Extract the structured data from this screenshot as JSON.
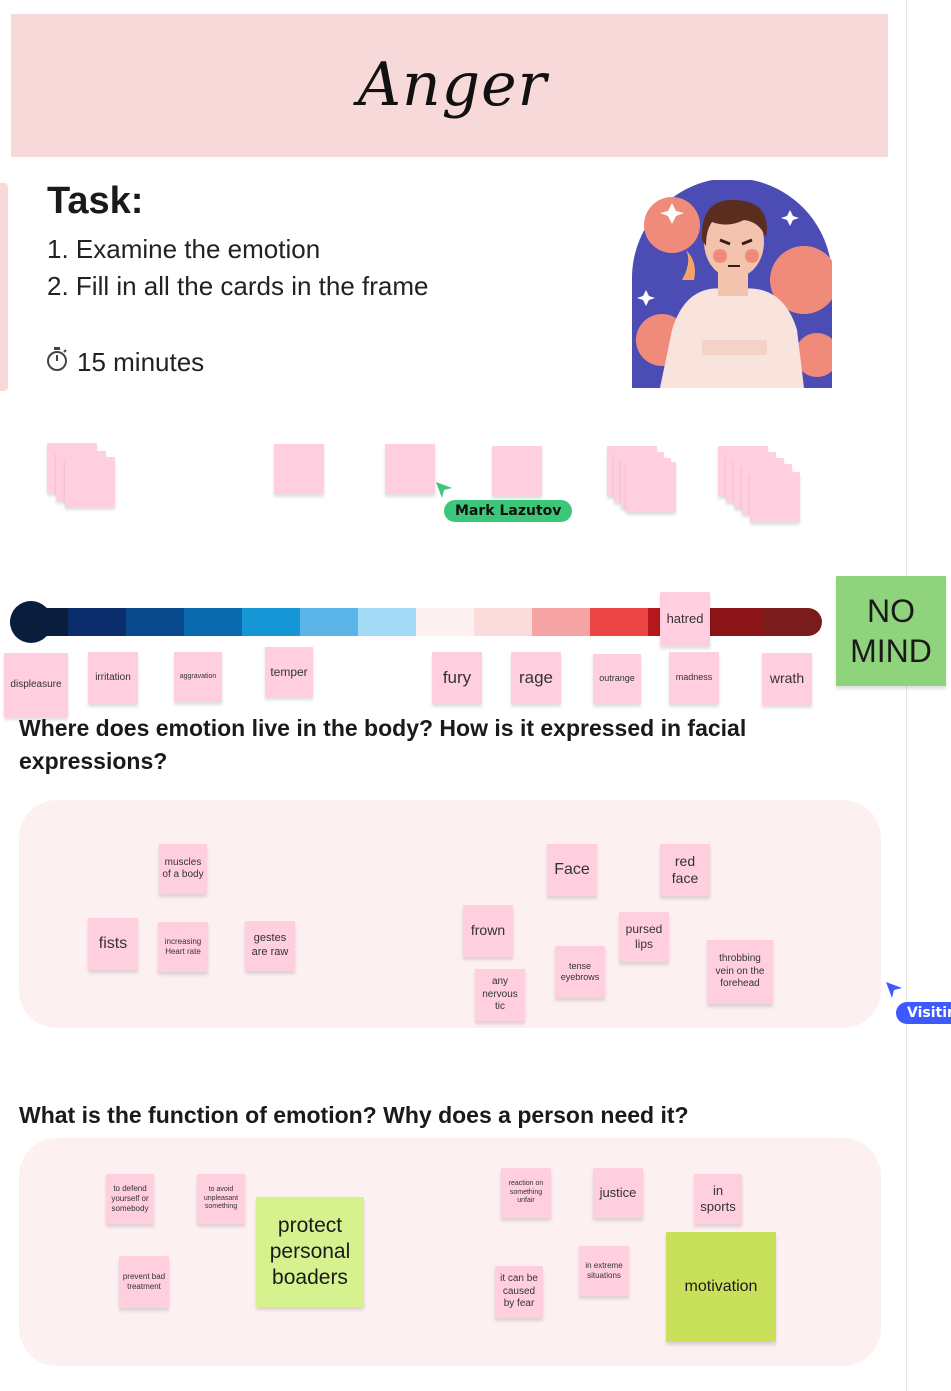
{
  "frame": {
    "title": "Anger"
  },
  "task": {
    "heading": "Task:",
    "steps": [
      "1. Examine the emotion",
      "2. Fill in all the cards in the frame"
    ],
    "timer_icon": "stopwatch-icon",
    "timer_text": "15 minutes"
  },
  "illustration": {
    "name": "angry-person-illustration"
  },
  "collaborators": {
    "cursor_one": {
      "name": "Mark Lazutov",
      "color": "#3cc67a"
    },
    "cursor_two": {
      "name": "Visiting",
      "color": "#3d5afe"
    }
  },
  "scale": {
    "colors": [
      "#0a1d3d",
      "#0c2d6b",
      "#0a4a8c",
      "#0a6aad",
      "#1597d6",
      "#5ab4e8",
      "#a3dbf7",
      "#fdf1f1",
      "#fbdcdc",
      "#f6a3a3",
      "#ec4545",
      "#b5171c",
      "#8b1418",
      "#7a1c1c"
    ],
    "words": [
      "displeasure",
      "irritation",
      "aggravation",
      "temper",
      "fury",
      "rage",
      "outrange",
      "madness",
      "wrath",
      "hatred"
    ],
    "no_mind_label": "NO MIND"
  },
  "question_one": {
    "text": "Where does emotion live in the body? How is it expressed in facial expressions?",
    "notes": [
      "muscles of a body",
      "fists",
      "increasing Heart rate",
      "gestes are raw",
      "frown",
      "any nervous tic",
      "Face",
      "tense eyebrows",
      "red face",
      "pursed lips",
      "throbbing vein on the forehead"
    ]
  },
  "question_two": {
    "text": "What is the function of emotion? Why does a person need it?",
    "notes": [
      "to defend yourself or somebody",
      "to avoid unpleasant something",
      "protect personal boaders",
      "prevent bad treatment",
      "reaction on something unfair",
      "justice",
      "in sports",
      "it can be caused by fear",
      "in extreme situations",
      "motivation"
    ]
  }
}
